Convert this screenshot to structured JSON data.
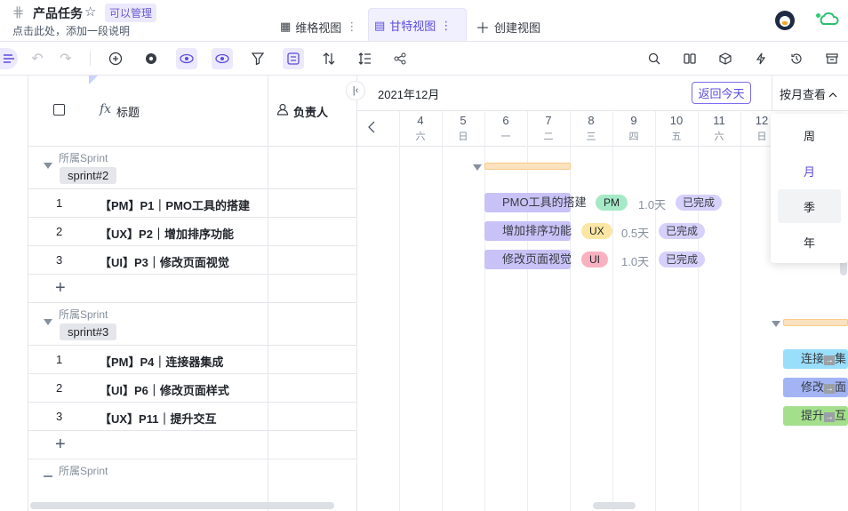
{
  "header": {
    "title": "产品任务",
    "subtitle": "点击此处，添加一段说明",
    "manage_badge": "可以管理",
    "tabs": [
      {
        "label": "维格视图",
        "active": false
      },
      {
        "label": "甘特视图",
        "active": true
      },
      {
        "label": "创建视图",
        "active": false
      }
    ]
  },
  "toolbar": {
    "left_icons": [
      "sidebar-toggle-icon",
      "undo-icon",
      "redo-icon",
      "add-record-icon",
      "settings-icon",
      "view-icon",
      "hidden-fields-icon",
      "filter-icon",
      "group-icon",
      "sort-icon",
      "row-height-icon",
      "share-icon"
    ],
    "right_icons": [
      "search-icon",
      "columns-icon",
      "widget-icon",
      "automation-icon",
      "history-icon",
      "archive-icon"
    ]
  },
  "grid": {
    "columns": [
      "标题",
      "负责人"
    ],
    "groups": [
      {
        "label": "所属Sprint",
        "name": "sprint#2",
        "rows": [
          {
            "index": "1",
            "title": "【PM】P1｜PMO工具的搭建"
          },
          {
            "index": "2",
            "title": "【UX】P2｜增加排序功能"
          },
          {
            "index": "3",
            "title": "【UI】P3｜修改页面视觉"
          }
        ]
      },
      {
        "label": "所属Sprint",
        "name": "sprint#3",
        "rows": [
          {
            "index": "1",
            "title": "【PM】P4｜连接器集成"
          },
          {
            "index": "2",
            "title": "【UI】P6｜修改页面样式"
          },
          {
            "index": "3",
            "title": "【UX】P11｜提升交互"
          }
        ]
      },
      {
        "label": "所属Sprint"
      }
    ],
    "add_row": "+"
  },
  "gantt": {
    "month": "2021年12月",
    "back_today": "返回今天",
    "view_by": "按月查看",
    "days": [
      {
        "num": "4",
        "wd": "六"
      },
      {
        "num": "5",
        "wd": "日"
      },
      {
        "num": "6",
        "wd": "一"
      },
      {
        "num": "7",
        "wd": "二"
      },
      {
        "num": "8",
        "wd": "三"
      },
      {
        "num": "9",
        "wd": "四"
      },
      {
        "num": "10",
        "wd": "五"
      },
      {
        "num": "11",
        "wd": "六"
      },
      {
        "num": "12",
        "wd": "日"
      }
    ],
    "tasks": [
      {
        "name": "PMO工具的搭建",
        "tag": "PM",
        "tag_color": "#a6e9c7",
        "duration": "1.0天",
        "status": "已完成"
      },
      {
        "name": "增加排序功能",
        "tag": "UX",
        "tag_color": "#fbe7a3",
        "duration": "0.5天",
        "status": "已完成"
      },
      {
        "name": "修改页面视觉",
        "tag": "UI",
        "tag_color": "#f9b1c0",
        "duration": "1.0天",
        "status": "已完成"
      }
    ],
    "tasks2": [
      {
        "name": "连接",
        "suffix": "集",
        "color": "#99defa"
      },
      {
        "name": "修改",
        "suffix": "面",
        "color": "#a3b4f5"
      },
      {
        "name": "提升",
        "suffix": "互",
        "color": "#a4e08c"
      }
    ]
  },
  "dropdown": {
    "items": [
      "周",
      "月",
      "季",
      "年"
    ],
    "selected": "月",
    "hovered": "季"
  }
}
